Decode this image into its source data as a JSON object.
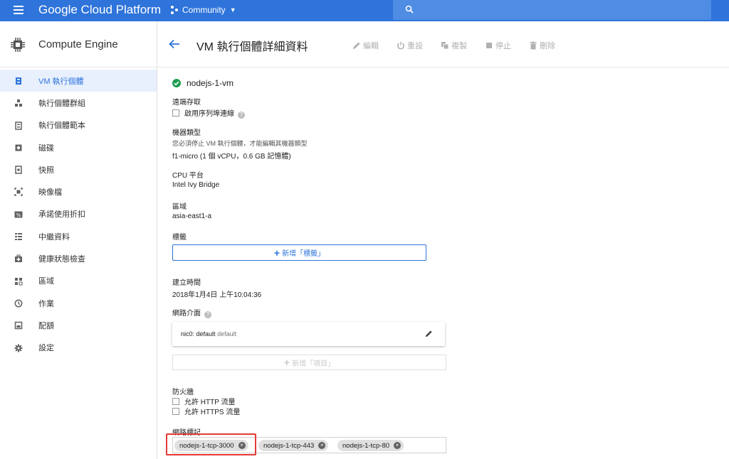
{
  "topbar": {
    "brand": "Google Cloud Platform",
    "project": "Community",
    "accent": "#2f74da"
  },
  "sidebar": {
    "title": "Compute Engine",
    "items": [
      {
        "label": "VM 執行個體",
        "icon": "vm-instance-icon",
        "active": true
      },
      {
        "label": "執行個體群組",
        "icon": "instance-group-icon"
      },
      {
        "label": "執行個體範本",
        "icon": "instance-template-icon"
      },
      {
        "label": "磁碟",
        "icon": "disk-icon"
      },
      {
        "label": "快照",
        "icon": "snapshot-icon"
      },
      {
        "label": "映像檔",
        "icon": "image-icon"
      },
      {
        "label": "承諾使用折扣",
        "icon": "percent-icon"
      },
      {
        "label": "中繼資料",
        "icon": "metadata-icon"
      },
      {
        "label": "健康狀態檢查",
        "icon": "health-check-icon"
      },
      {
        "label": "區域",
        "icon": "zone-icon"
      },
      {
        "label": "作業",
        "icon": "clock-icon"
      },
      {
        "label": "配額",
        "icon": "quota-icon"
      },
      {
        "label": "設定",
        "icon": "gear-icon"
      }
    ]
  },
  "header": {
    "title": "VM 執行個體詳細資料",
    "actions": {
      "edit": "編輯",
      "reset": "重設",
      "clone": "複製",
      "stop": "停止",
      "delete": "刪除"
    }
  },
  "details": {
    "vm_name": "nodejs-1-vm",
    "remote_access": {
      "label": "遠端存取",
      "serial_port": "啟用序列埠連線"
    },
    "machine_type": {
      "label": "機器類型",
      "note": "您必須停止 VM 執行個體，才能編輯其機器類型",
      "value": "f1-micro (1 個 vCPU，0.6 GB 記憶體)"
    },
    "cpu_platform": {
      "label": "CPU 平台",
      "value": "Intel Ivy Bridge"
    },
    "zone": {
      "label": "區域",
      "value": "asia-east1-a"
    },
    "labels": {
      "label": "標籤",
      "add_button": "新增「標籤」"
    },
    "created": {
      "label": "建立時間",
      "value": "2018年1月4日 上午10:04:36"
    },
    "network_interfaces": {
      "label": "網路介面",
      "nic_name": "nic0: default",
      "nic_network": "default",
      "add_button": "新增「項目」"
    },
    "firewall": {
      "label": "防火牆",
      "allow_http": "允許 HTTP 流量",
      "allow_https": "允許 HTTPS 流量"
    },
    "network_tags": {
      "label": "網路標記",
      "tags": [
        "nodejs-1-tcp-3000",
        "nodejs-1-tcp-443",
        "nodejs-1-tcp-80"
      ]
    }
  }
}
